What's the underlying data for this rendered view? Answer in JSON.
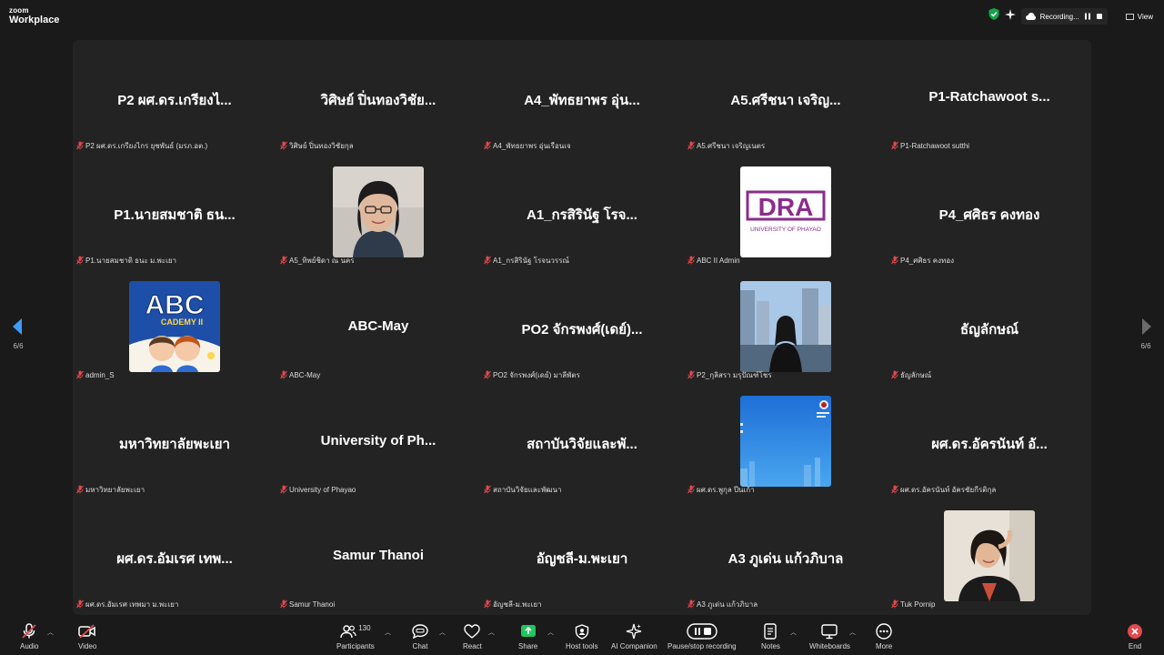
{
  "app": {
    "brand_line1": "zoom",
    "brand_line2": "Workplace"
  },
  "top": {
    "recording_label": "Recording...",
    "view_label": "View"
  },
  "colors": {
    "accent_green": "#16a34a",
    "share_green": "#22c55e",
    "muted_red": "#e5484d",
    "tile_bg": "#232323"
  },
  "pagination": {
    "left": "6/6",
    "right": "6/6"
  },
  "tiles": [
    {
      "name": "P2 ผศ.ดร.เกรียงไ...",
      "label": "P2 ผศ.ดร.เกรียงไกร ยุชพันธ์ (มรภ.อต.)"
    },
    {
      "name": "วิศิษย์ ปิ่นทองวิชัย...",
      "label": "วิศิษย์ ปิ่นทองวิชัยกุล"
    },
    {
      "name": "A4_พัทธยาพร อุ่น...",
      "label": "A4_พัทธยาพร อุ่นเรือนเจ"
    },
    {
      "name": "A5.ศรีชนา เจริญ...",
      "label": "A5.ศรีชนา เจริญเนตร"
    },
    {
      "name": "P1-Ratchawoot s...",
      "label": "P1-Ratchawoot sutthi"
    },
    {
      "name": "P1.นายสมชาติ ธน...",
      "label": "P1.นายสมชาติ ธนะ ม.พะเยา"
    },
    {
      "name": "",
      "label": "A5_ทิพย์ชิดา ณ นคร",
      "photo": "woman-glasses"
    },
    {
      "name": "A1_กรสิรินัฐ โรจ...",
      "label": "A1_กรสิรินัฐ โรจนวรรณ์"
    },
    {
      "name": "",
      "label": "ABC II Admin",
      "photo": "dra-logo",
      "logo_text": "DRA",
      "logo_sub": "UNIVERSITY OF PHAYAO"
    },
    {
      "name": "P4_ศศิธร คงทอง",
      "label": "P4_ศศิธร คงทอง"
    },
    {
      "name": "",
      "label": "admin_S",
      "photo": "abc-academy",
      "logo_text": "ABC",
      "logo_sub": "CADEMY II"
    },
    {
      "name": "ABC-May",
      "label": "ABC-May"
    },
    {
      "name": "PO2 จักรพงศ์(เดย์)...",
      "label": "PO2 จักรพงศ์(เดย์) มาลีพัตร"
    },
    {
      "name": "",
      "label": "P2_กุลิสรา มรุปัณฑ์โชร",
      "photo": "woman-city"
    },
    {
      "name": "ธัญลักษณ์",
      "label": "ธัญลักษณ์"
    },
    {
      "name": "มหาวิทยาลัยพะเยา",
      "label": "มหาวิทยาลัยพะเยา"
    },
    {
      "name": "University of Ph...",
      "label": "University of Phayao"
    },
    {
      "name": "สถาบันวิจัยและพั...",
      "label": "สถาบันวิจัยและพัฒนา"
    },
    {
      "name": "",
      "label": "ผศ.ดร.พูกุล ปีนเก้า",
      "photo": "blue-slide"
    },
    {
      "name": "ผศ.ดร.อัครนันท์ อั...",
      "label": "ผศ.ดร.อัครนันท์ อัครชัยกีรติกุล"
    },
    {
      "name": "ผศ.ดร.อัมเรศ เทพ...",
      "label": "ผศ.ดร.อัมเรศ เทพมา ม.พะเยา"
    },
    {
      "name": "Samur Thanoi",
      "label": "Samur Thanoi"
    },
    {
      "name": "อัญชลี-ม.พะเยา",
      "label": "อัญชลี-ม.พะเยา"
    },
    {
      "name": "A3 ภูเด่น แก้วภิบาล",
      "label": "A3 ภูเด่น แก้วภิบาล"
    },
    {
      "name": "",
      "label": "Tuk Pornip",
      "photo": "woman-hair"
    }
  ],
  "toolbar": {
    "audio": "Audio",
    "video": "Video",
    "participants": "Participants",
    "participants_count": "130",
    "chat": "Chat",
    "react": "React",
    "share": "Share",
    "host_tools": "Host tools",
    "ai_companion": "AI Companion",
    "recording": "Pause/stop recording",
    "notes": "Notes",
    "whiteboards": "Whiteboards",
    "more": "More",
    "end": "End"
  }
}
